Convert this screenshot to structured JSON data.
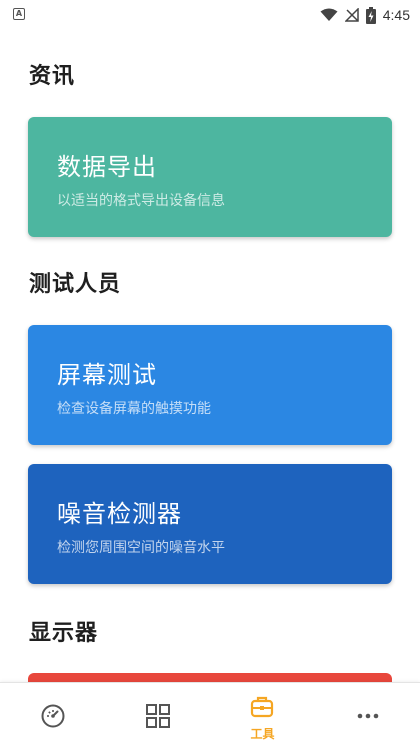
{
  "status_bar": {
    "notification_icon": "app-notification-icon",
    "time": "4:45",
    "icons": [
      "wifi-icon",
      "signal-off-icon",
      "battery-charging-icon"
    ]
  },
  "sections": [
    {
      "title": "资讯",
      "cards": [
        {
          "title": "数据导出",
          "subtitle": "以适当的格式导出设备信息",
          "color": "#4DB6A0"
        }
      ]
    },
    {
      "title": "测试人员",
      "cards": [
        {
          "title": "屏幕测试",
          "subtitle": "检查设备屏幕的触摸功能",
          "color": "#2B87E3"
        },
        {
          "title": "噪音检测器",
          "subtitle": "检测您周围空间的噪音水平",
          "color": "#1E63BE"
        }
      ]
    },
    {
      "title": "显示器",
      "cards": [
        {
          "color": "#E8473C"
        }
      ]
    }
  ],
  "bottom_nav": {
    "active_color": "#F5A623",
    "inactive_color": "#555555",
    "items": [
      {
        "icon": "speedometer-icon",
        "active": false
      },
      {
        "icon": "grid-icon",
        "active": false
      },
      {
        "icon": "toolbox-icon",
        "label": "工具",
        "active": true
      },
      {
        "icon": "more-icon",
        "active": false
      }
    ]
  }
}
